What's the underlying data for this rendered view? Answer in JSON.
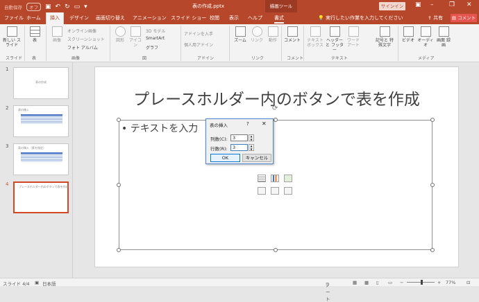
{
  "app": {
    "autosave": "自動保存",
    "autosave_state": "オフ",
    "doc_title": "表の作成.pptx",
    "context_tab_group": "描画ツール",
    "signin": "サインイン"
  },
  "tabs": [
    "ファイル",
    "ホーム",
    "挿入",
    "デザイン",
    "画面切り替え",
    "アニメーション",
    "スライド ショー",
    "校閲",
    "表示",
    "ヘルプ",
    "書式"
  ],
  "active_tab": "挿入",
  "tellme": "実行したい作業を入力してください",
  "share": "共有",
  "comment": "コメント",
  "ribbon": {
    "new_slide": "新しい スライド",
    "table": "表",
    "images": "画像",
    "online_images": "オンライン画像",
    "screenshot": "スクリーンショット",
    "photo_album": "フォト アルバム",
    "shapes": "図形",
    "icons": "アイコン",
    "models_3d": "3D モデル",
    "smartart": "SmartArt",
    "chart": "グラフ",
    "get_addins": "アドインを入手",
    "my_addins": "個人用アドイン",
    "zoom": "ズーム",
    "link": "リンク",
    "action": "動作",
    "comment_btn": "コメント",
    "textbox": "テキスト ボックス",
    "header_footer": "ヘッダーと フッター",
    "wordart": "ワード アート",
    "symbol": "記号と 特殊文字",
    "video": "ビデオ",
    "audio": "オーディオ",
    "screen_recording": "画面 録画",
    "groups": {
      "slides": "スライド",
      "table": "表",
      "images": "画像",
      "illustrations": "図",
      "addins": "アドイン",
      "links": "リンク",
      "comments": "コメント",
      "text": "テキスト",
      "media": "メディア"
    }
  },
  "thumbnails": [
    {
      "num": "1",
      "title": "表の作成"
    },
    {
      "num": "2",
      "title": "表の挿入"
    },
    {
      "num": "3",
      "title": "表の挿入（罫を指定）"
    },
    {
      "num": "4",
      "title": "プレースホルダー内のボタンで表を作成"
    }
  ],
  "slide": {
    "title": "プレースホルダー内のボタンで表を作成",
    "bullet": "• テキストを入力"
  },
  "dialog": {
    "title": "表の挿入",
    "help": "?",
    "close": "✕",
    "cols_label": "列数(C):",
    "cols_value": "3",
    "rows_label": "行数(R):",
    "rows_value": "3",
    "ok": "OK",
    "cancel": "キャンセル"
  },
  "status": {
    "slide_pos": "スライド 4/4",
    "language": "日本語",
    "notes": "ノート",
    "zoom": "77%"
  },
  "colors": {
    "accent": "#b7472a",
    "selected_thumb": "#d24726"
  }
}
